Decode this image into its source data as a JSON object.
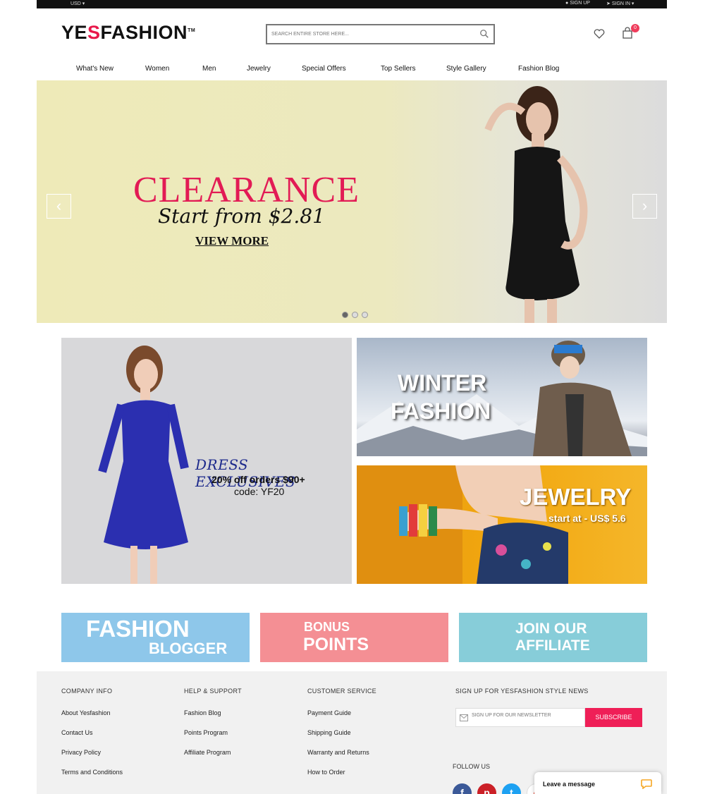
{
  "topbar": {
    "currency": "USD",
    "signup": "SIGN UP",
    "signin": "SIGN IN"
  },
  "logo": {
    "prefix": "YE",
    "accent": "S",
    "suffix": "FASHION",
    "tm": "TM"
  },
  "search": {
    "placeholder": "SEARCH ENTIRE STORE HERE..."
  },
  "cart": {
    "count": "0"
  },
  "nav": [
    "What's New",
    "Women",
    "Men",
    "Jewelry",
    "Special Offers",
    "Top Sellers",
    "Style Gallery",
    "Fashion Blog"
  ],
  "hero": {
    "headline": "CLEARANCE",
    "subline": "Start from $2.81",
    "cta": "VIEW MORE",
    "prev": "‹",
    "next": "›",
    "slides": 3,
    "active_slide": 1
  },
  "promos": {
    "dress": {
      "title": "DRESS EXCLUSIVES",
      "offer": "20% off orders $90+",
      "code": "code: YF20"
    },
    "winter": {
      "line1": "WINTER",
      "line2": "FASHION"
    },
    "jewelry": {
      "title": "JEWELRY",
      "price": "start at - US$ 5.6"
    }
  },
  "tiles": {
    "blogger": {
      "line1": "FASHION",
      "line2": "BLOGGER"
    },
    "bonus": {
      "line1": "BONUS",
      "line2": "POINTS"
    },
    "affiliate": {
      "line1": "JOIN OUR",
      "line2": "AFFILIATE"
    }
  },
  "footer": {
    "company": {
      "title": "COMPANY INFO",
      "links": [
        "About Yesfashion",
        "Contact Us",
        "Privacy Policy",
        "Terms and Conditions"
      ]
    },
    "help": {
      "title": "HELP & SUPPORT",
      "links": [
        "Fashion Blog",
        "Points Program",
        "Affiliate Program"
      ]
    },
    "service": {
      "title": "CUSTOMER SERVICE",
      "links": [
        "Payment Guide",
        "Shipping Guide",
        "Warranty and Returns",
        "How to Order"
      ]
    },
    "newsletter": {
      "title": "SIGN UP FOR YESFASHION STYLE NEWS",
      "placeholder": "SIGN UP FOR OUR NEWSLETTER",
      "button": "SUBSCRIBE"
    },
    "follow": "FOLLOW US",
    "social": [
      "f",
      "p",
      "t",
      "g"
    ]
  },
  "chat": {
    "label": "Leave a message"
  },
  "colors": {
    "brand": "#e8184a",
    "subscribe": "#ef1f57",
    "tile_blue": "#8ec7ea",
    "tile_pink": "#f48f94",
    "tile_teal": "#87cdd9",
    "facebook": "#3b5998",
    "pinterest": "#cb2027",
    "twitter": "#1da1f2",
    "google": "#ffffff"
  }
}
